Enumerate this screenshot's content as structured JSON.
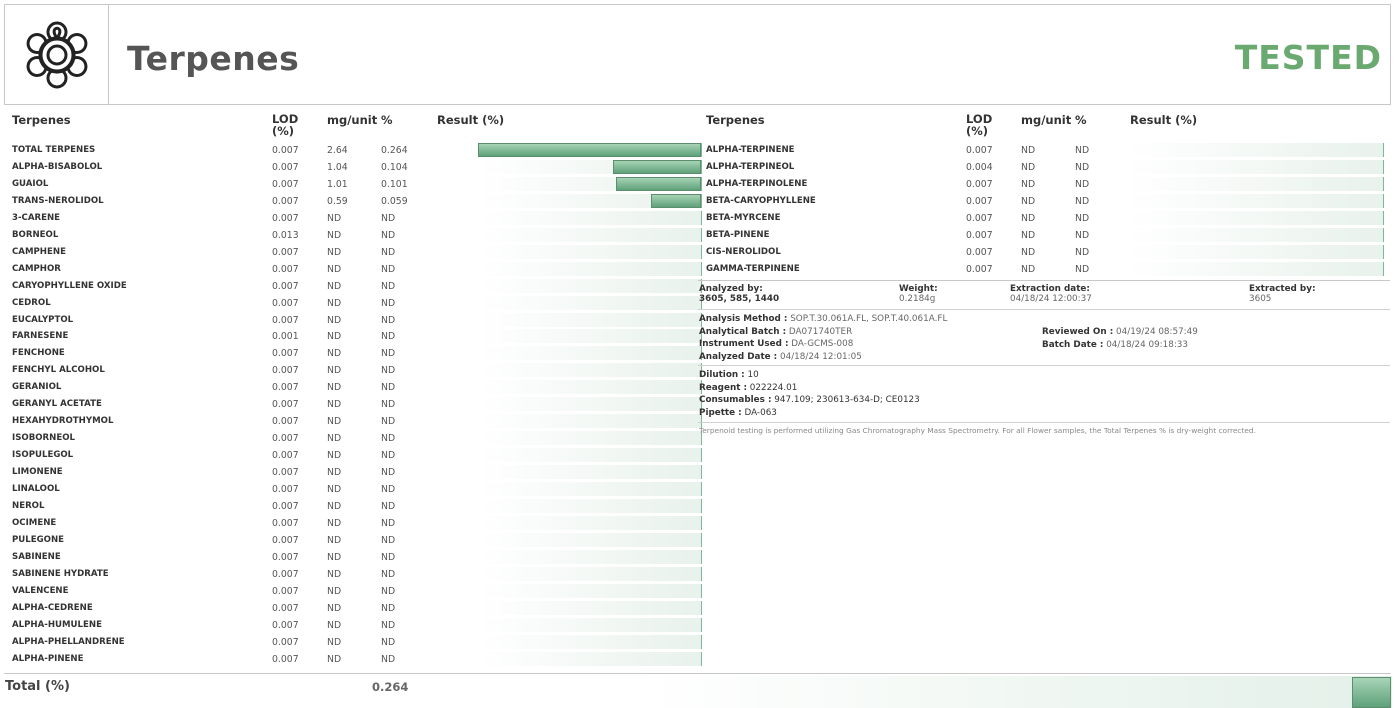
{
  "header": {
    "title": "Terpenes",
    "status": "TESTED",
    "status_color": "#6aa96f",
    "logo_icon": "flower-icon"
  },
  "columns": {
    "name": "Terpenes",
    "lod": "LOD",
    "lod_unit": "(%)",
    "mg": "mg/unit",
    "pct": "%",
    "result": "Result (%)"
  },
  "left_rows": [
    {
      "name": "TOTAL TERPENES",
      "lod": "0.007",
      "mg": "2.64",
      "pct": "0.264",
      "value": 0.264
    },
    {
      "name": "ALPHA-BISABOLOL",
      "lod": "0.007",
      "mg": "1.04",
      "pct": "0.104",
      "value": 0.104
    },
    {
      "name": "GUAIOL",
      "lod": "0.007",
      "mg": "1.01",
      "pct": "0.101",
      "value": 0.101
    },
    {
      "name": "TRANS-NEROLIDOL",
      "lod": "0.007",
      "mg": "0.59",
      "pct": "0.059",
      "value": 0.059
    },
    {
      "name": "3-CARENE",
      "lod": "0.007",
      "mg": "ND",
      "pct": "ND",
      "value": 0
    },
    {
      "name": "BORNEOL",
      "lod": "0.013",
      "mg": "ND",
      "pct": "ND",
      "value": 0
    },
    {
      "name": "CAMPHENE",
      "lod": "0.007",
      "mg": "ND",
      "pct": "ND",
      "value": 0
    },
    {
      "name": "CAMPHOR",
      "lod": "0.007",
      "mg": "ND",
      "pct": "ND",
      "value": 0
    },
    {
      "name": "CARYOPHYLLENE OXIDE",
      "lod": "0.007",
      "mg": "ND",
      "pct": "ND",
      "value": 0
    },
    {
      "name": "CEDROL",
      "lod": "0.007",
      "mg": "ND",
      "pct": "ND",
      "value": 0
    },
    {
      "name": "EUCALYPTOL",
      "lod": "0.007",
      "mg": "ND",
      "pct": "ND",
      "value": 0
    },
    {
      "name": "FARNESENE",
      "lod": "0.001",
      "mg": "ND",
      "pct": "ND",
      "value": 0
    },
    {
      "name": "FENCHONE",
      "lod": "0.007",
      "mg": "ND",
      "pct": "ND",
      "value": 0
    },
    {
      "name": "FENCHYL ALCOHOL",
      "lod": "0.007",
      "mg": "ND",
      "pct": "ND",
      "value": 0
    },
    {
      "name": "GERANIOL",
      "lod": "0.007",
      "mg": "ND",
      "pct": "ND",
      "value": 0
    },
    {
      "name": "GERANYL ACETATE",
      "lod": "0.007",
      "mg": "ND",
      "pct": "ND",
      "value": 0
    },
    {
      "name": "HEXAHYDROTHYMOL",
      "lod": "0.007",
      "mg": "ND",
      "pct": "ND",
      "value": 0
    },
    {
      "name": "ISOBORNEOL",
      "lod": "0.007",
      "mg": "ND",
      "pct": "ND",
      "value": 0
    },
    {
      "name": "ISOPULEGOL",
      "lod": "0.007",
      "mg": "ND",
      "pct": "ND",
      "value": 0
    },
    {
      "name": "LIMONENE",
      "lod": "0.007",
      "mg": "ND",
      "pct": "ND",
      "value": 0
    },
    {
      "name": "LINALOOL",
      "lod": "0.007",
      "mg": "ND",
      "pct": "ND",
      "value": 0
    },
    {
      "name": "NEROL",
      "lod": "0.007",
      "mg": "ND",
      "pct": "ND",
      "value": 0
    },
    {
      "name": "OCIMENE",
      "lod": "0.007",
      "mg": "ND",
      "pct": "ND",
      "value": 0
    },
    {
      "name": "PULEGONE",
      "lod": "0.007",
      "mg": "ND",
      "pct": "ND",
      "value": 0
    },
    {
      "name": "SABINENE",
      "lod": "0.007",
      "mg": "ND",
      "pct": "ND",
      "value": 0
    },
    {
      "name": "SABINENE HYDRATE",
      "lod": "0.007",
      "mg": "ND",
      "pct": "ND",
      "value": 0
    },
    {
      "name": "VALENCENE",
      "lod": "0.007",
      "mg": "ND",
      "pct": "ND",
      "value": 0
    },
    {
      "name": "ALPHA-CEDRENE",
      "lod": "0.007",
      "mg": "ND",
      "pct": "ND",
      "value": 0
    },
    {
      "name": "ALPHA-HUMULENE",
      "lod": "0.007",
      "mg": "ND",
      "pct": "ND",
      "value": 0
    },
    {
      "name": "ALPHA-PHELLANDRENE",
      "lod": "0.007",
      "mg": "ND",
      "pct": "ND",
      "value": 0
    },
    {
      "name": "ALPHA-PINENE",
      "lod": "0.007",
      "mg": "ND",
      "pct": "ND",
      "value": 0
    }
  ],
  "right_rows": [
    {
      "name": "ALPHA-TERPINENE",
      "lod": "0.007",
      "mg": "ND",
      "pct": "ND",
      "value": 0
    },
    {
      "name": "ALPHA-TERPINEOL",
      "lod": "0.004",
      "mg": "ND",
      "pct": "ND",
      "value": 0
    },
    {
      "name": "ALPHA-TERPINOLENE",
      "lod": "0.007",
      "mg": "ND",
      "pct": "ND",
      "value": 0
    },
    {
      "name": "BETA-CARYOPHYLLENE",
      "lod": "0.007",
      "mg": "ND",
      "pct": "ND",
      "value": 0
    },
    {
      "name": "BETA-MYRCENE",
      "lod": "0.007",
      "mg": "ND",
      "pct": "ND",
      "value": 0
    },
    {
      "name": "BETA-PINENE",
      "lod": "0.007",
      "mg": "ND",
      "pct": "ND",
      "value": 0
    },
    {
      "name": "CIS-NEROLIDOL",
      "lod": "0.007",
      "mg": "ND",
      "pct": "ND",
      "value": 0
    },
    {
      "name": "GAMMA-TERPINENE",
      "lod": "0.007",
      "mg": "ND",
      "pct": "ND",
      "value": 0
    }
  ],
  "result_scale_max": 0.264,
  "analysis": {
    "analyzed_by_label": "Analyzed by:",
    "analyzed_by": "3605, 585, 1440",
    "weight_label": "Weight:",
    "weight": "0.2184g",
    "extraction_date_label": "Extraction date:",
    "extraction_date": "04/18/24 12:00:37",
    "extracted_by_label": "Extracted by:",
    "extracted_by": "3605",
    "method_label": "Analysis Method :",
    "method": "SOP.T.30.061A.FL, SOP.T.40.061A.FL",
    "batch_label": "Analytical Batch :",
    "batch": "DA071740TER",
    "instrument_label": "Instrument Used :",
    "instrument": "DA-GCMS-008",
    "analyzed_date_label": "Analyzed Date :",
    "analyzed_date": "04/18/24 12:01:05",
    "reviewed_label": "Reviewed On :",
    "reviewed": "04/19/24 08:57:49",
    "batch_date_label": "Batch Date :",
    "batch_date": "04/18/24 09:18:33",
    "dilution_label": "Dilution :",
    "dilution": "10",
    "reagent_label": "Reagent :",
    "reagent": "022224.01",
    "consumables_label": "Consumables :",
    "consumables": "947.109; 230613-634-D; CE0123",
    "pipette_label": "Pipette :",
    "pipette": "DA-063",
    "note": "Terpenoid testing is performed utilizing Gas Chromatography Mass Spectrometry. For all Flower samples, the Total Terpenes % is dry-weight corrected."
  },
  "footer": {
    "total_label": "Total (%)",
    "total_value": "0.264",
    "total_fraction": 1
  }
}
